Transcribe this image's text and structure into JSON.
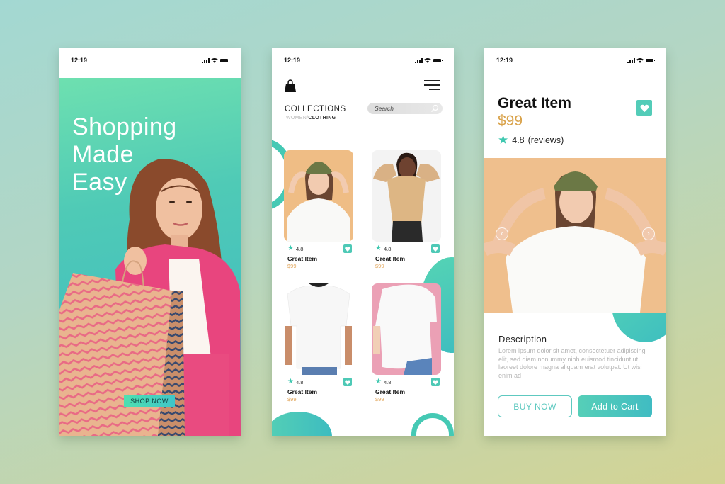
{
  "colors": {
    "accent": "#4ec9b6",
    "price": "#d9a24a",
    "background_top": "#a3d8d2",
    "background_bottom": "#d3d394"
  },
  "status_bar": {
    "time": "12:19",
    "icons": [
      "signal-icon",
      "wifi-icon",
      "battery-icon"
    ]
  },
  "screen1": {
    "hero_title": "Shopping\nMade\nEasy",
    "cta_label": "SHOP NOW"
  },
  "screen2": {
    "bag_icon": "shopping-bag-icon",
    "menu_icon": "hamburger-menu-icon",
    "title": "COLLECTIONS",
    "breadcrumb": {
      "parent": "WOMEN",
      "separator": "/",
      "current": "CLOTHING"
    },
    "search": {
      "placeholder": "Search",
      "value": ""
    },
    "products": [
      {
        "rating": "4.8",
        "name": "Great Item",
        "price": "$99"
      },
      {
        "rating": "4.8",
        "name": "Great Item",
        "price": "$99"
      },
      {
        "rating": "4.8",
        "name": "Great Item",
        "price": "$99"
      },
      {
        "rating": "4.8",
        "name": "Great Item",
        "price": "$99"
      }
    ]
  },
  "screen3": {
    "title": "Great Item",
    "price": "$99",
    "rating": "4.8",
    "reviews_label": "(reviews)",
    "description_title": "Description",
    "description_text": "Lorem ipsum dolor sit amet, consectetuer adipiscing elit, sed diam nonummy nibh euismod tincidunt ut laoreet dolore magna aliquam erat volutpat. Ut wisi enim ad",
    "buy_now_label": "BUY NOW",
    "add_to_cart_label": "Add to Cart"
  }
}
